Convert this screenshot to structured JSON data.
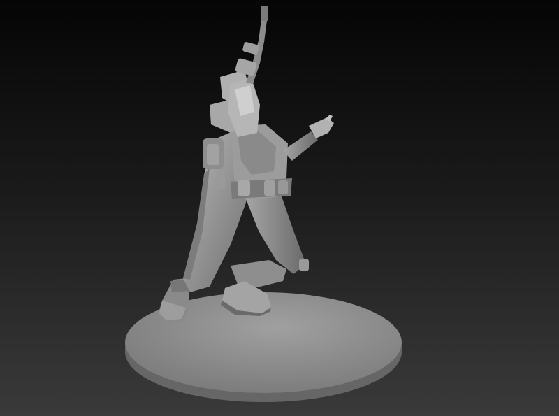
{
  "scene": {
    "subject": "sculpted-miniature-figure",
    "colors": {
      "background_top": "#050505",
      "background_bottom": "#3a3a3a",
      "sculpt_light": "#b4b4b4",
      "sculpt_mid": "#8c8c8c",
      "sculpt_dark": "#5a5a5a",
      "base_top": "#8e8e8e",
      "base_side": "#6a6a6a"
    }
  }
}
